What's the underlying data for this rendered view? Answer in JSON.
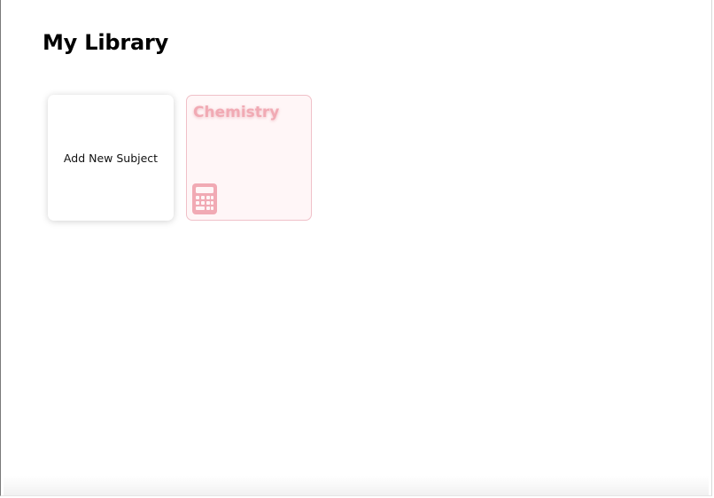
{
  "page": {
    "title": "My Library"
  },
  "library": {
    "add_card_label": "Add New Subject",
    "subjects": [
      {
        "name": "Chemistry",
        "icon": "calculator-icon",
        "color": "#f1aab4",
        "background": "#fff6f7",
        "border": "#f0c0c8"
      }
    ]
  }
}
